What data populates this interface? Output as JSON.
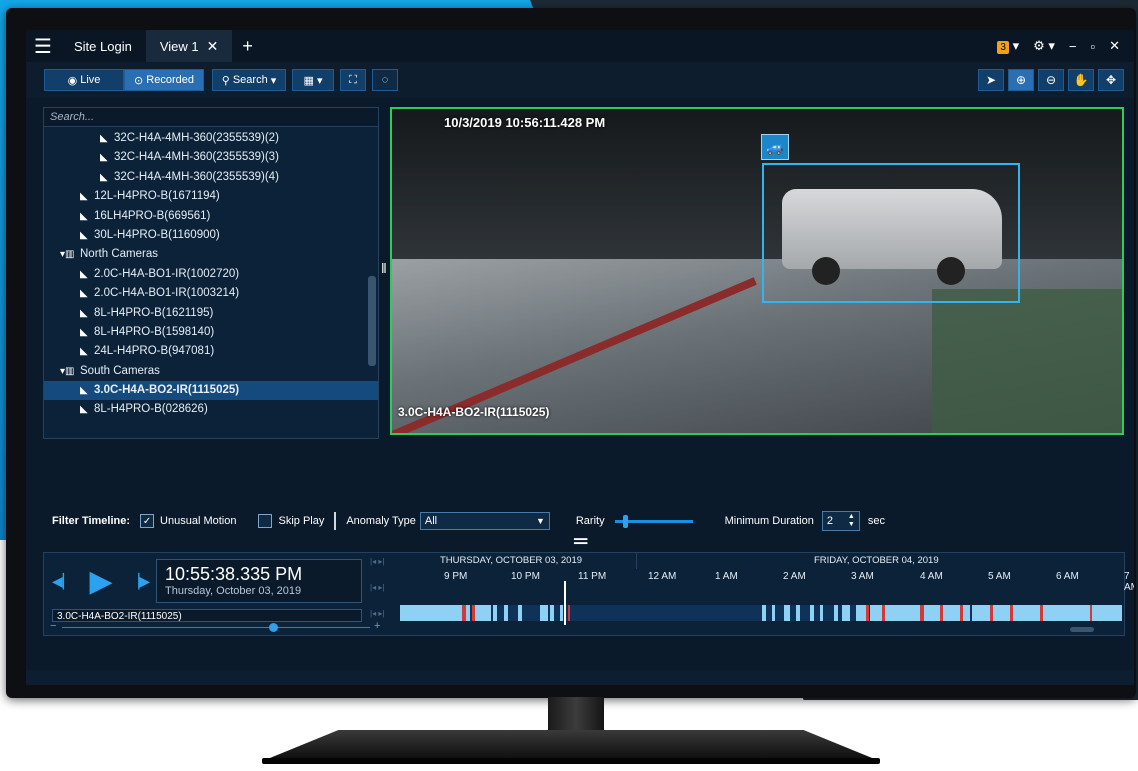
{
  "app": {
    "menu_icon": "hamburger-icon",
    "tabs": [
      {
        "label": "Site Login"
      },
      {
        "label": "View 1",
        "close": "✕"
      }
    ],
    "add_tab": "+",
    "notification_count": "3",
    "window_controls": [
      "settings-icon",
      "minimize",
      "maximize",
      "close"
    ]
  },
  "toolbar": {
    "live_label": "Live",
    "recorded_label": "Recorded",
    "search_label": "Search",
    "tools": [
      "pointer",
      "zoom-in",
      "zoom-out",
      "pan-hand",
      "move"
    ]
  },
  "tree": {
    "search_placeholder": "Search...",
    "items": [
      {
        "label": "32C-H4A-4MH-360(2355539)(2)",
        "level": 2
      },
      {
        "label": "32C-H4A-4MH-360(2355539)(3)",
        "level": 2
      },
      {
        "label": "32C-H4A-4MH-360(2355539)(4)",
        "level": 2
      },
      {
        "label": "12L-H4PRO-B(1671194)",
        "level": 1
      },
      {
        "label": "16LH4PRO-B(669561)",
        "level": 1
      },
      {
        "label": "30L-H4PRO-B(1160900)",
        "level": 1
      },
      {
        "label": "North Cameras",
        "level": 0,
        "group": true
      },
      {
        "label": "2.0C-H4A-BO1-IR(1002720)",
        "level": 1
      },
      {
        "label": "2.0C-H4A-BO1-IR(1003214)",
        "level": 1
      },
      {
        "label": "8L-H4PRO-B(1621195)",
        "level": 1
      },
      {
        "label": "8L-H4PRO-B(1598140)",
        "level": 1
      },
      {
        "label": "24L-H4PRO-B(947081)",
        "level": 1
      },
      {
        "label": "South Cameras",
        "level": 0,
        "group": true
      },
      {
        "label": "3.0C-H4A-BO2-IR(1115025)",
        "level": 1,
        "selected": true
      },
      {
        "label": "8L-H4PRO-B(028626)",
        "level": 1
      }
    ]
  },
  "video": {
    "timestamp": "10/3/2019 10:56:11.428 PM",
    "camera_name": "3.0C-H4A-BO2-IR(1115025)",
    "detection_icon": "car-icon"
  },
  "filter": {
    "label": "Filter Timeline:",
    "unusual_motion_label": "Unusual Motion",
    "unusual_motion_checked": true,
    "skip_play_label": "Skip Play",
    "skip_play_checked": false,
    "anomaly_type_label": "Anomaly Type",
    "anomaly_type_value": "All",
    "rarity_label": "Rarity",
    "min_duration_label": "Minimum Duration",
    "min_duration_value": "2",
    "unit": "sec"
  },
  "timeline": {
    "time": "10:55:38.335 PM",
    "date": "Thursday, October 03, 2019",
    "camera": "3.0C-H4A-BO2-IR(1115025)",
    "day1": "THURSDAY, OCTOBER 03, 2019",
    "day2": "FRIDAY, OCTOBER 04, 2019",
    "hours": [
      "9 PM",
      "10 PM",
      "11 PM",
      "12 AM",
      "1 AM",
      "2 AM",
      "3 AM",
      "4 AM",
      "5 AM",
      "6 AM",
      "7 AM"
    ],
    "colors": {
      "motion": "#8fd0f5",
      "anomaly": "#d23a3a",
      "accent": "#2aa2f0"
    }
  }
}
